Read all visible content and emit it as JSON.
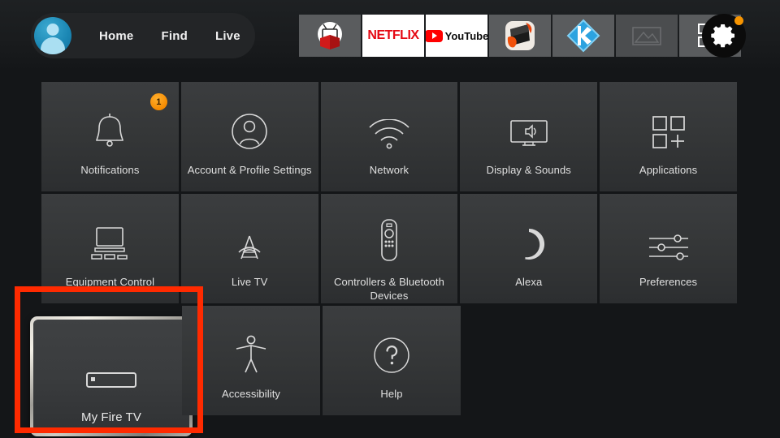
{
  "topbar": {
    "profile_icon": "avatar-person-icon",
    "nav_links": [
      {
        "label": "Home"
      },
      {
        "label": "Find"
      },
      {
        "label": "Live"
      }
    ],
    "app_shortcuts": [
      {
        "name": "tv-box-app-icon",
        "label": ""
      },
      {
        "name": "netflix-app-icon",
        "label": "NETFLIX"
      },
      {
        "name": "youtube-app-icon",
        "label": "YouTube"
      },
      {
        "name": "downloader-app-icon",
        "label": ""
      },
      {
        "name": "kodi-app-icon",
        "label": ""
      },
      {
        "name": "placeholder-app-icon",
        "label": ""
      },
      {
        "name": "apps-grid-icon",
        "label": ""
      }
    ],
    "settings_button": {
      "name": "gear-icon",
      "has_update_dot": true,
      "dot_color": "#f79400"
    }
  },
  "grid": {
    "rows": [
      [
        {
          "label": "Notifications",
          "icon": "bell-icon",
          "badge": "1"
        },
        {
          "label": "Account & Profile Settings",
          "icon": "person-circle-icon",
          "badge": null
        },
        {
          "label": "Network",
          "icon": "wifi-icon",
          "badge": null
        },
        {
          "label": "Display & Sounds",
          "icon": "tv-speaker-icon",
          "badge": null
        },
        {
          "label": "Applications",
          "icon": "apps-squares-icon",
          "badge": null
        }
      ],
      [
        {
          "label": "Equipment Control",
          "icon": "tv-equipment-icon",
          "badge": null
        },
        {
          "label": "Live TV",
          "icon": "broadcast-tower-icon",
          "badge": null
        },
        {
          "label": "Controllers & Bluetooth Devices",
          "icon": "remote-control-icon",
          "badge": null
        },
        {
          "label": "Alexa",
          "icon": "alexa-ring-icon",
          "badge": null
        },
        {
          "label": "Preferences",
          "icon": "sliders-icon",
          "badge": null
        }
      ],
      [
        {
          "label": "My Fire TV",
          "icon": "firetv-stick-icon",
          "badge": null,
          "focused": true
        },
        {
          "label": "Accessibility",
          "icon": "accessibility-person-icon",
          "badge": null
        },
        {
          "label": "Help",
          "icon": "question-circle-icon",
          "badge": null
        }
      ]
    ]
  },
  "annotation": {
    "highlight_target": "My Fire TV",
    "color": "#ff2a00"
  },
  "colors": {
    "background": "#141618",
    "tile": "#373939",
    "accent_orange": "#f79400",
    "netflix_red": "#e50914",
    "youtube_red": "#ff0000",
    "kodi_blue": "#31a3dd",
    "avatar_blue": "#1b87b4",
    "annotation_red": "#ff2a00"
  }
}
